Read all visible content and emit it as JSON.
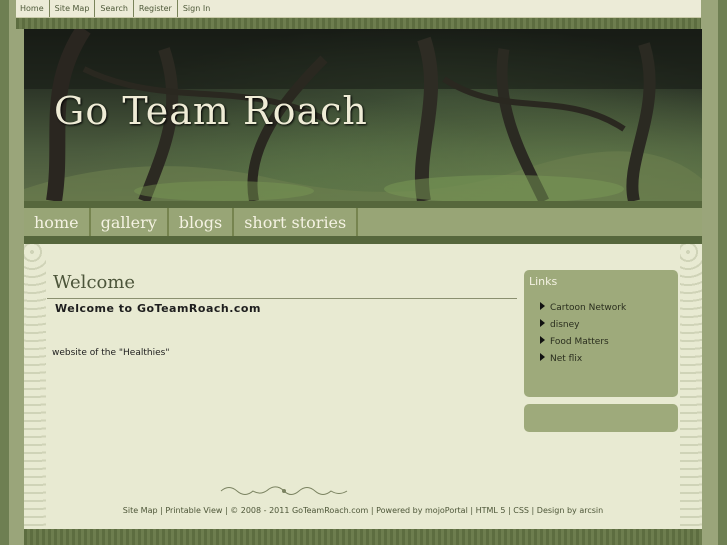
{
  "topnav": [
    "Home",
    "Site Map",
    "Search",
    "Register",
    "Sign In"
  ],
  "banner": {
    "title": "Go Team Roach"
  },
  "nav": [
    "home",
    "gallery",
    "blogs",
    "short stories"
  ],
  "main": {
    "heading": "Welcome",
    "subheading": "Welcome to GoTeamRoach.com",
    "body": "website of the \"Healthies\""
  },
  "sidebar": {
    "heading": "Links",
    "links": [
      "Cartoon Network",
      "disney",
      "Food Matters",
      "Net flix"
    ]
  },
  "footer": {
    "sitemap": "Site Map",
    "printable": "Printable View",
    "copyright": "© 2008 - 2011 GoTeamRoach.com",
    "powered": "Powered by mojoPortal",
    "html5": "HTML 5",
    "css": "CSS",
    "design": "Design by arcsin"
  }
}
